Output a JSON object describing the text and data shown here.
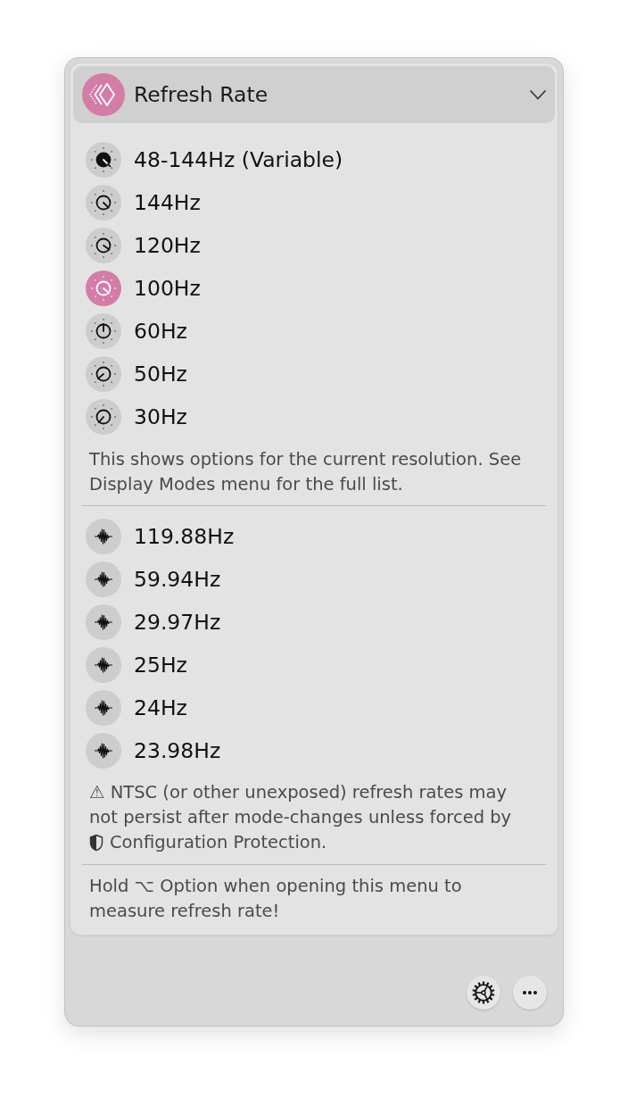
{
  "section": {
    "title": "Refresh Rate"
  },
  "rates": [
    {
      "label": "48-144Hz (Variable)",
      "kind": "variable",
      "selected": false
    },
    {
      "label": "144Hz",
      "kind": "fixed",
      "selected": false
    },
    {
      "label": "120Hz",
      "kind": "fixed",
      "selected": false
    },
    {
      "label": "100Hz",
      "kind": "fixed",
      "selected": true
    },
    {
      "label": "60Hz",
      "kind": "fixed",
      "selected": false
    },
    {
      "label": "50Hz",
      "kind": "fixed",
      "selected": false
    },
    {
      "label": "30Hz",
      "kind": "fixed",
      "selected": false
    }
  ],
  "rates_note": "This shows options for the current resolution. See Display Modes menu for the full list.",
  "ntsc_rates": [
    {
      "label": "119.88Hz",
      "selected": false
    },
    {
      "label": "59.94Hz",
      "selected": false
    },
    {
      "label": "29.97Hz",
      "selected": false
    },
    {
      "label": "25Hz",
      "selected": false
    },
    {
      "label": "24Hz",
      "selected": false
    },
    {
      "label": "23.98Hz",
      "selected": false
    }
  ],
  "ntsc_warning": {
    "text": "⚠ NTSC (or other unexposed) refresh rates may not persist after mode-changes unless forced by",
    "protection": "Configuration Protection."
  },
  "hint": "Hold ⌥ Option when opening this menu to measure refresh rate!"
}
